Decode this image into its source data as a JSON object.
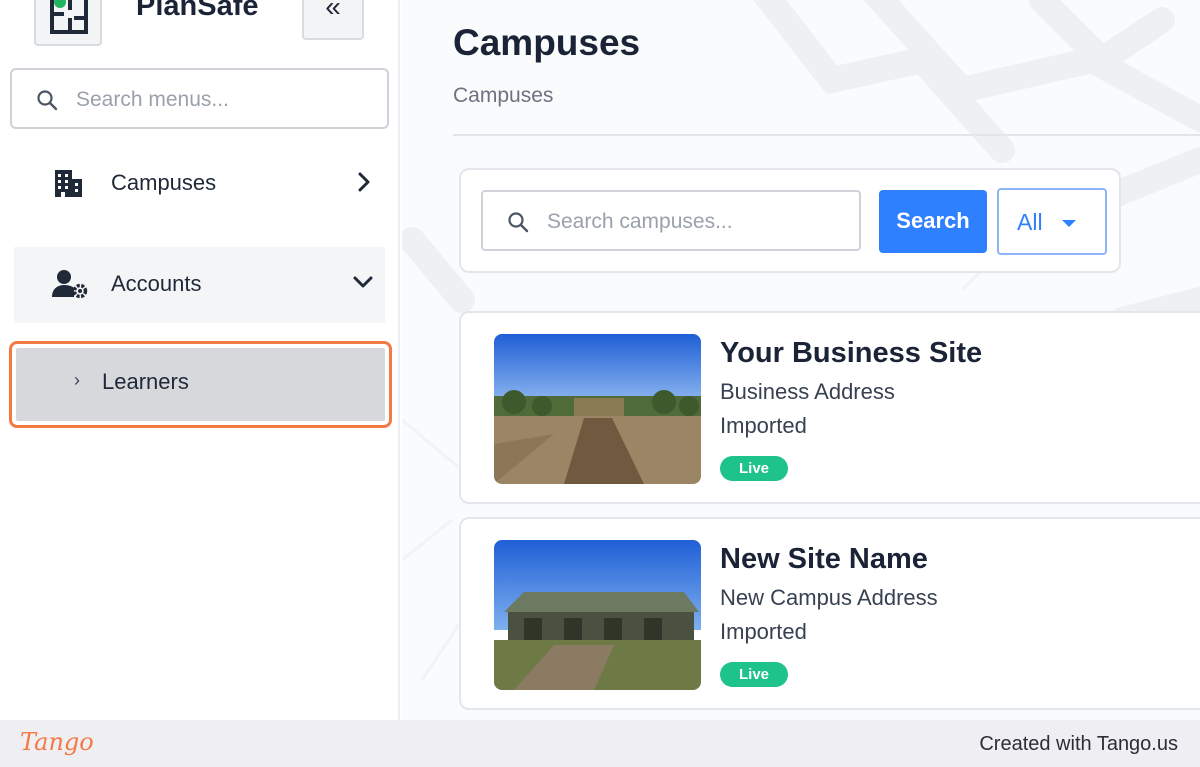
{
  "app": {
    "name": "PlanSafe",
    "collapse_label": "«"
  },
  "sidebar": {
    "search_placeholder": "Search menus...",
    "items": [
      {
        "label": "Campuses",
        "icon": "building-icon",
        "chevron": "chevron-right-icon"
      },
      {
        "label": "Accounts",
        "icon": "user-gear-icon",
        "chevron": "chevron-down-icon"
      }
    ],
    "sub_items": [
      {
        "label": "Learners",
        "marker": "›"
      }
    ]
  },
  "main": {
    "title": "Campuses",
    "breadcrumb": "Campuses",
    "search": {
      "placeholder": "Search campuses...",
      "button_label": "Search",
      "filter_value": "All"
    },
    "campuses": [
      {
        "name": "Your Business Site",
        "address": "Business Address",
        "source": "Imported",
        "status": "Live"
      },
      {
        "name": "New Site Name",
        "address": "New Campus Address",
        "source": "Imported",
        "status": "Live"
      }
    ]
  },
  "footer": {
    "logo": "Tango",
    "credit": "Created with Tango.us"
  },
  "colors": {
    "primary": "#2f80ff",
    "live_badge": "#1ec28b",
    "highlight": "#f47a45"
  }
}
